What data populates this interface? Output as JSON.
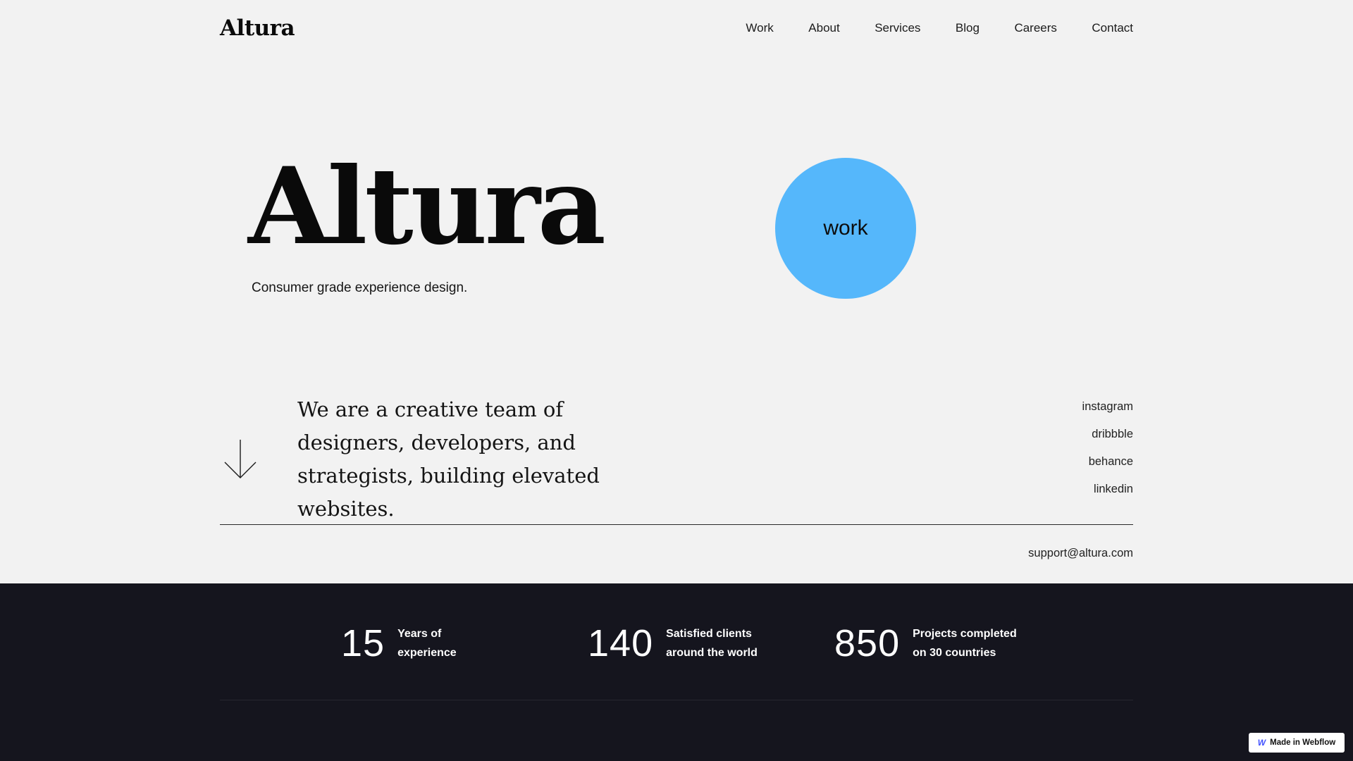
{
  "header": {
    "brand": "Altura",
    "nav": [
      "Work",
      "About",
      "Services",
      "Blog",
      "Careers",
      "Contact"
    ]
  },
  "hero": {
    "title": "Altura",
    "subtitle": "Consumer grade experience design.",
    "circle_label": "work",
    "circle_color": "#55b7fb"
  },
  "intro": {
    "text": "We are a creative team of designers, developers, and strategists, building elevated websites.",
    "arrow_icon": "arrow-down-icon"
  },
  "social": [
    "instagram",
    "dribbble",
    "behance",
    "linkedin"
  ],
  "contact": {
    "email": "support@altura.com"
  },
  "stats": [
    {
      "number": "15",
      "label": "Years of experience"
    },
    {
      "number": "140",
      "label": "Satisfied clients around the world"
    },
    {
      "number": "850",
      "label": "Projects completed on 30 countries"
    }
  ],
  "badge": {
    "icon": "webflow-logo-icon",
    "icon_glyph": "W",
    "text": "Made in Webflow"
  },
  "colors": {
    "background": "#f2f2f2",
    "dark_band": "#15151e",
    "accent": "#55b7fb"
  }
}
